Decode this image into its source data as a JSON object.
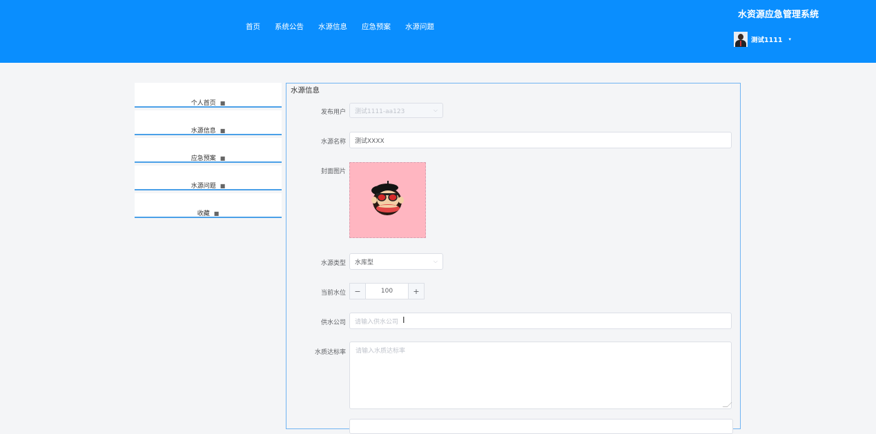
{
  "header": {
    "nav": [
      "首页",
      "系统公告",
      "水源信息",
      "应急预案",
      "水源问题"
    ],
    "app_title": "水资源应急管理系统",
    "user_name": "测试1111",
    "caret": "▾",
    "bg_color": "#0a8efe"
  },
  "sidebar": {
    "items": [
      {
        "label": "个人首页",
        "icon": "briefcase-icon"
      },
      {
        "label": "水源信息",
        "icon": "briefcase-icon"
      },
      {
        "label": "应急预案",
        "icon": "briefcase-icon"
      },
      {
        "label": "水源问题",
        "icon": "briefcase-icon"
      },
      {
        "label": "收藏",
        "icon": "briefcase-icon"
      }
    ]
  },
  "form": {
    "title": "水源信息",
    "publisher": {
      "label": "发布用户",
      "value": "测试1111-aa123"
    },
    "name": {
      "label": "水源名称",
      "value": "测试XXXX"
    },
    "cover": {
      "label": "封面图片"
    },
    "type": {
      "label": "水源类型",
      "value": "水库型"
    },
    "level": {
      "label": "当前水位",
      "value": "100",
      "minus": "−",
      "plus": "+"
    },
    "company": {
      "label": "供水公司",
      "placeholder": "请输入供水公司"
    },
    "quality": {
      "label": "水质达标率",
      "placeholder": "请输入水质达标率"
    }
  }
}
